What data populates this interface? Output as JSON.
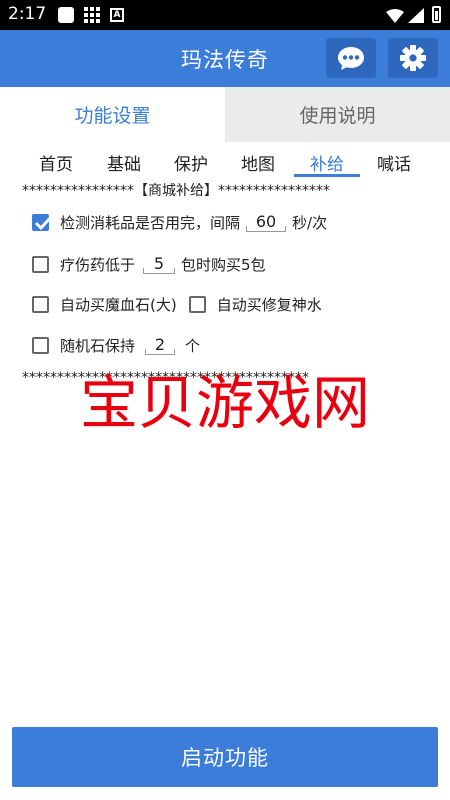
{
  "status_bar": {
    "time": "2:17"
  },
  "header": {
    "title": "玛法传奇"
  },
  "main_tabs": [
    {
      "label": "功能设置",
      "active": true
    },
    {
      "label": "使用说明",
      "active": false
    }
  ],
  "sub_tabs": [
    {
      "label": "首页"
    },
    {
      "label": "基础"
    },
    {
      "label": "保护"
    },
    {
      "label": "地图"
    },
    {
      "label": "补给",
      "active": true
    },
    {
      "label": "喊话"
    }
  ],
  "section": {
    "header": "****************【商城补给】****************",
    "footer": "*****************************************"
  },
  "options": {
    "check_consumables": {
      "checked": true,
      "label": "检测消耗品是否用完，间隔",
      "value": "60",
      "unit": "秒/次"
    },
    "heal_potion": {
      "checked": false,
      "label": "疗伤药低于",
      "value": "5",
      "unit": "包时购买5包"
    },
    "auto_buy_mana": {
      "checked": false,
      "label": "自动买魔血石(大)"
    },
    "auto_buy_repair": {
      "checked": false,
      "label": "自动买修复神水"
    },
    "random_stone": {
      "checked": false,
      "label": "随机石保持",
      "value": "2",
      "unit": "个"
    }
  },
  "watermark": "宝贝游戏网",
  "start_button": {
    "label": "启动功能"
  },
  "colors": {
    "accent": "#3B7DD8",
    "watermark": "#E8000F"
  }
}
